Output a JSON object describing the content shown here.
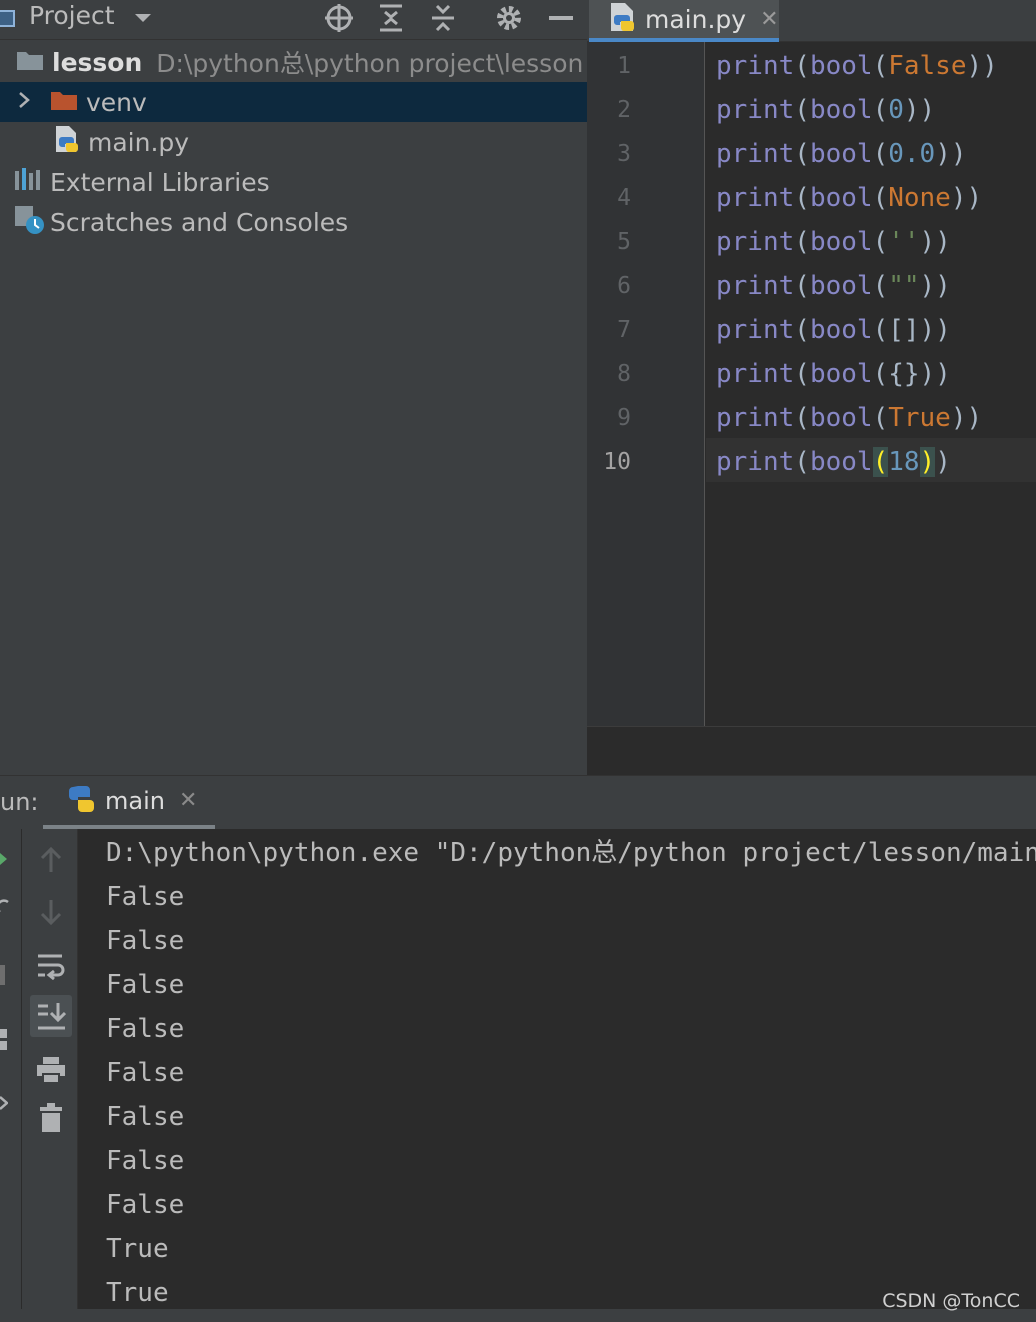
{
  "project_panel": {
    "title": "Project",
    "tree": {
      "root_name": "lesson",
      "root_path": "D:\\python总\\python project\\lesson",
      "venv": "venv",
      "main_file": "main.py",
      "external_libraries": "External Libraries",
      "scratches": "Scratches and Consoles"
    }
  },
  "editor": {
    "tab_label": "main.py",
    "close_glyph": "✕",
    "line_numbers": [
      "1",
      "2",
      "3",
      "4",
      "5",
      "6",
      "7",
      "8",
      "9",
      "10"
    ],
    "current_line": 10,
    "lines": [
      [
        "print",
        "(",
        "bool",
        "(",
        "False",
        "))"
      ],
      [
        "print",
        "(",
        "bool",
        "(",
        "0",
        "))"
      ],
      [
        "print",
        "(",
        "bool",
        "(",
        "0.0",
        "))"
      ],
      [
        "print",
        "(",
        "bool",
        "(",
        "None",
        "))"
      ],
      [
        "print",
        "(",
        "bool",
        "(",
        "''",
        "))"
      ],
      [
        "print",
        "(",
        "bool",
        "(",
        "\"\"",
        "))"
      ],
      [
        "print",
        "(",
        "bool",
        "(",
        "[]",
        "))"
      ],
      [
        "print",
        "(",
        "bool",
        "(",
        "{}",
        "))"
      ],
      [
        "print",
        "(",
        "bool",
        "(",
        "True",
        "))"
      ],
      [
        "print",
        "(",
        "bool",
        "(",
        "18",
        ")",
        ")"
      ]
    ]
  },
  "run_panel": {
    "label": "un:",
    "tab_label": "main",
    "close_glyph": "✕",
    "console_lines": [
      "D:\\python\\python.exe \"D:/python总/python project/lesson/main.py\"",
      "False",
      "False",
      "False",
      "False",
      "False",
      "False",
      "False",
      "False",
      "True",
      "True"
    ]
  },
  "watermark": "CSDN @TonCC",
  "colors": {
    "panel_bg": "#3c3f41",
    "editor_bg": "#2b2b2b",
    "selection": "#0d293e",
    "tab_accent": "#4a88c7",
    "keyword": "#cc7832",
    "builtin": "#8888c6",
    "number": "#6897bb",
    "folder_venv": "#b9532e"
  }
}
